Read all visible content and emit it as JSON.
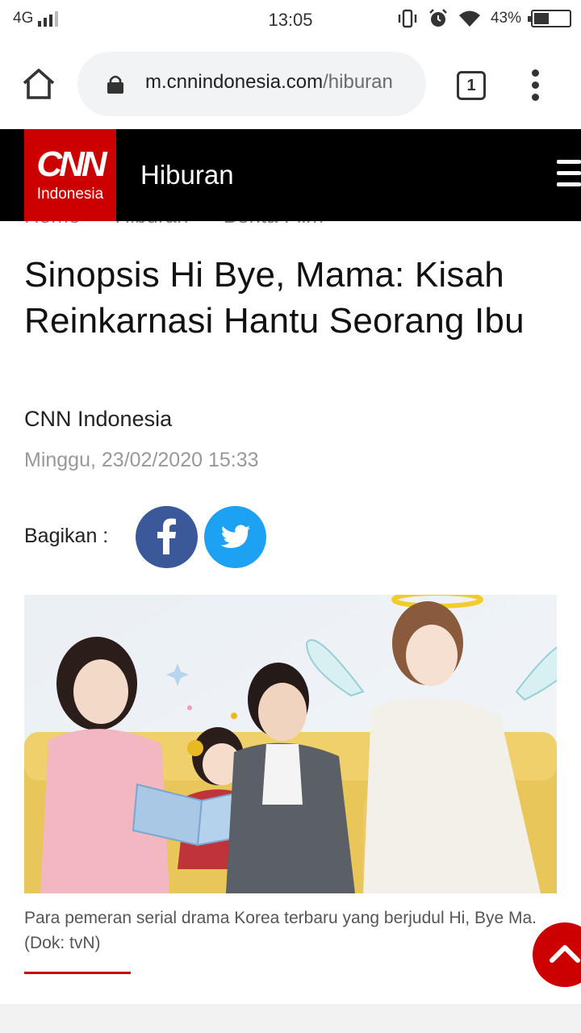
{
  "status_bar": {
    "network": "4G",
    "time": "13:05",
    "battery": "43%"
  },
  "browser": {
    "url_host": "m.cnnindonesia.com",
    "url_path": "/hiburan",
    "tab_count": "1"
  },
  "site_header": {
    "logo_brand": "CNN",
    "logo_sub": "Indonesia",
    "section": "Hiburan"
  },
  "breadcrumb": {
    "items": [
      "Home",
      "Hiburan",
      "Berita Film"
    ],
    "separator": "›"
  },
  "article": {
    "title": "Sinopsis Hi Bye, Mama: Kisah Reinkarnasi Hantu Seorang Ibu",
    "author": "CNN Indonesia",
    "date": "Minggu, 23/02/2020 15:33",
    "share_label": "Bagikan :",
    "caption": "Para pemeran serial drama Korea terbaru yang berjudul Hi, Bye Ma. (Dok: tvN)"
  },
  "colors": {
    "brand_red": "#cc0000",
    "facebook": "#3b5998",
    "twitter": "#1da1f2"
  },
  "icons": {
    "home": "home-icon",
    "lock": "lock-icon",
    "menu": "more-vert-icon",
    "hamburger": "hamburger-icon",
    "facebook": "facebook-icon",
    "twitter": "twitter-icon",
    "scroll_top": "chevron-up-icon"
  }
}
